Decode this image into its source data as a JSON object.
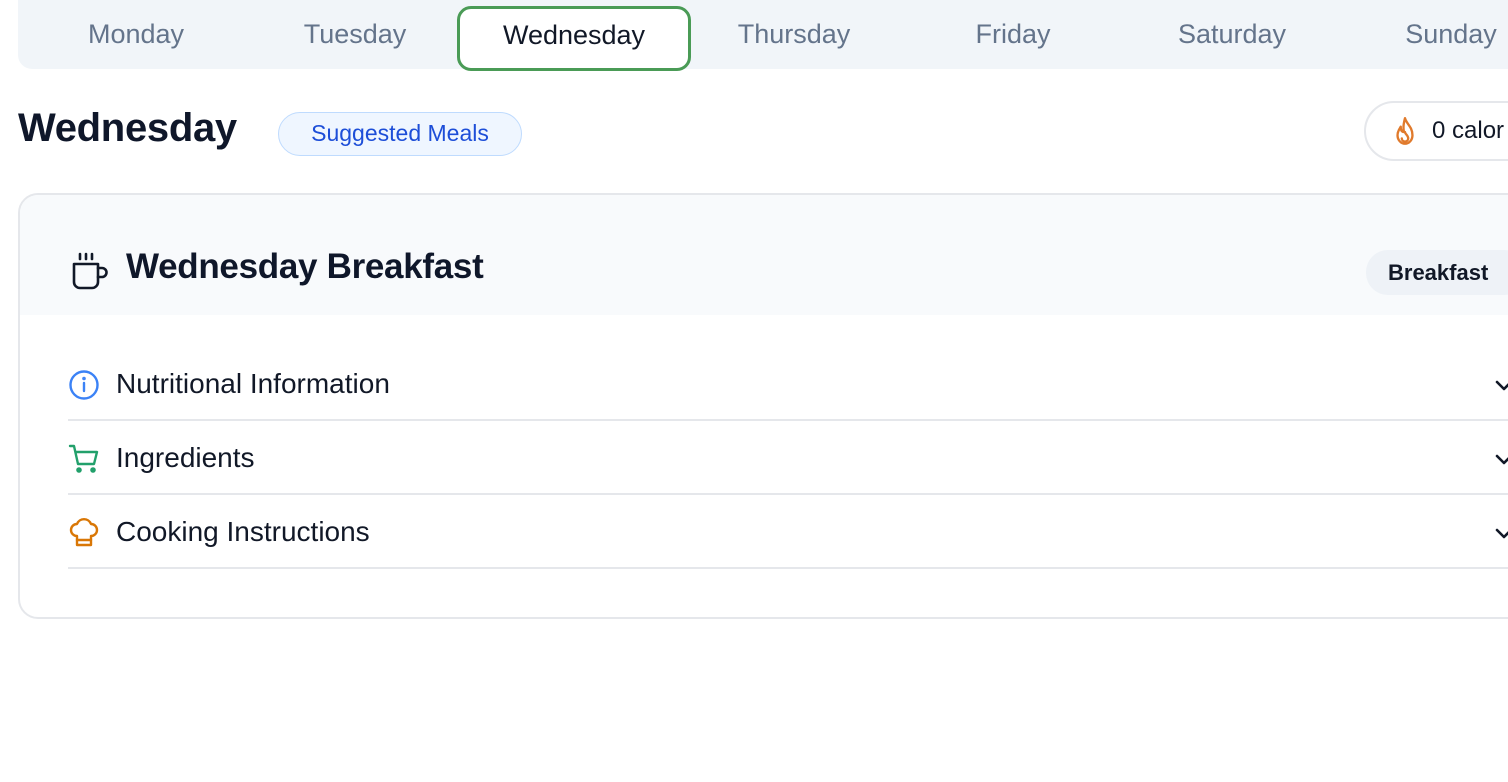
{
  "days": {
    "items": [
      "Monday",
      "Tuesday",
      "Wednesday",
      "Thursday",
      "Friday",
      "Saturday",
      "Sunday"
    ],
    "active": "Wednesday"
  },
  "header": {
    "title": "Wednesday",
    "badge": "Suggested Meals",
    "calories": "0 calor"
  },
  "meal": {
    "title": "Wednesday Breakfast",
    "type": "Breakfast",
    "sections": [
      {
        "label": "Nutritional Information",
        "icon": "info-icon"
      },
      {
        "label": "Ingredients",
        "icon": "cart-icon"
      },
      {
        "label": "Cooking Instructions",
        "icon": "chef-hat-icon"
      }
    ]
  },
  "colors": {
    "active_tab_border": "#4a9b56",
    "badge_text": "#1d4ed8",
    "flame": "#e07a2c",
    "info_icon": "#3b82f6",
    "cart_icon": "#22a06b",
    "chef_icon": "#d97706"
  }
}
